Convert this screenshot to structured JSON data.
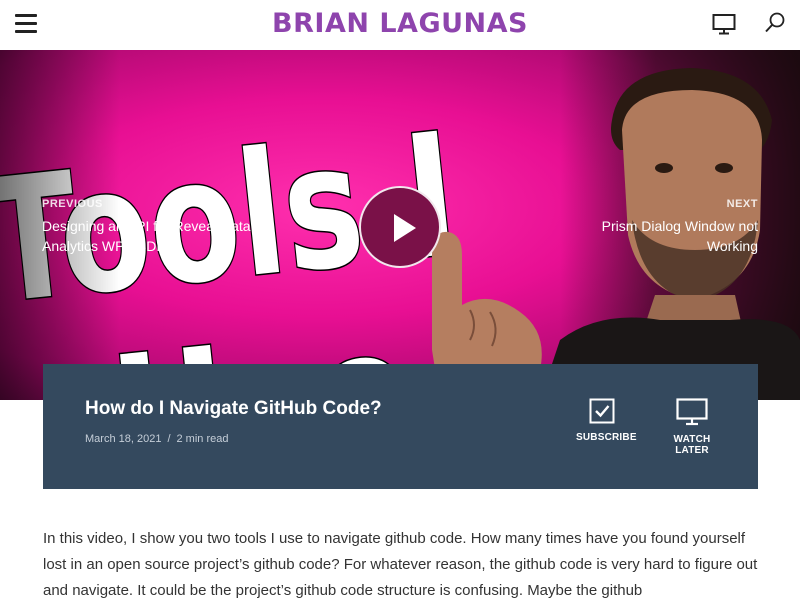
{
  "header": {
    "site_title": "BRIAN LAGUNAS",
    "menu_icon": "hamburger-menu-icon",
    "video_icon": "monitor-icon",
    "search_icon": "search-icon"
  },
  "hero": {
    "thumbnail_text": [
      "Tools I",
      "Use"
    ],
    "previous": {
      "kicker": "PREVIOUS",
      "title": "Designing an API for Reveal Data Analytics WPF SDK"
    },
    "next": {
      "kicker": "NEXT",
      "title": "Prism Dialog Window not Working"
    },
    "play_icon": "play-icon"
  },
  "post": {
    "title": "How do I Navigate GitHub Code?",
    "date": "March 18, 2021",
    "separator": "/",
    "read_time": "2 min read",
    "subscribe_label": "SUBSCRIBE",
    "watch_later_label": "WATCH LATER"
  },
  "article": {
    "intro": "In this video, I show you two tools I use to navigate github code. How many times have you found yourself lost in an open source project’s github code? For whatever reason, the github code is very hard to figure out and navigate. It could be the project’s github code structure is confusing. Maybe the github"
  },
  "colors": {
    "brand": "#8e44ad",
    "card": "#34495e",
    "hero": "#e80f93"
  }
}
